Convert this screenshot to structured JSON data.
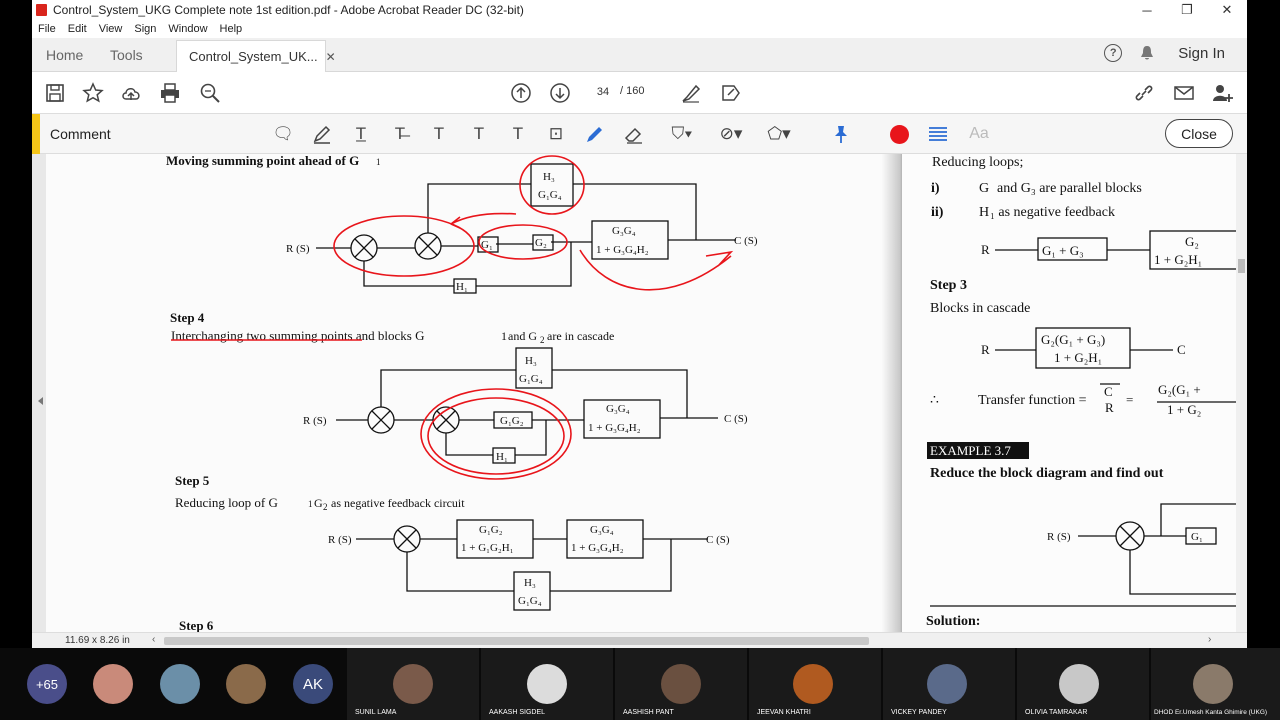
{
  "window": {
    "title": "Control_System_UKG Complete note 1st edition.pdf - Adobe Acrobat Reader DC (32-bit)",
    "minimize": "─",
    "restore": "❐",
    "close": "✕"
  },
  "menu": [
    "File",
    "Edit",
    "View",
    "Sign",
    "Window",
    "Help"
  ],
  "tabs": {
    "home": "Home",
    "tools": "Tools",
    "doc": "Control_System_UK...",
    "doc_close": "✕"
  },
  "header_right": {
    "help": "?",
    "signin": "Sign In"
  },
  "toolbar": {
    "page_current": "34",
    "page_total": "/ 160"
  },
  "comment": {
    "label": "Comment",
    "close": "Close",
    "color": "#e8151b",
    "accent": "#f5c518",
    "font_btn": "Aa"
  },
  "doc_left": {
    "heading_top": "Moving summing point ahead of G",
    "step4": "Step 4",
    "step4_desc": "Interchanging two summing points and blocks G",
    "step5": "Step 5",
    "step5_desc": "Reducing loop of G",
    "step6": "Step 6"
  },
  "doc_right": {
    "reducing": "Reducing loops;",
    "i": "i)",
    "i_text": "G",
    "ii": "ii)",
    "ii_text": "H",
    "step3": "Step 3",
    "cascade": "Blocks in cascade",
    "therefore": "∴",
    "tf": "Transfer function =",
    "example": "EXAMPLE 3.7",
    "example_text": "Reduce the block diagram and find out",
    "solution": "Solution:"
  },
  "status": {
    "dimensions": "11.69 x 8.26 in"
  },
  "participants": {
    "more": "+65",
    "ak": "AK",
    "names": [
      "SUNIL LAMA",
      "AAKASH SIGDEL",
      "AASHISH PANT",
      "JEEVAN KHATRI",
      "VICKEY PANDEY",
      "OLIVIA TAMRAKAR",
      "DHOD Er.Umesh Kanta Ghimire (UKG)"
    ]
  }
}
